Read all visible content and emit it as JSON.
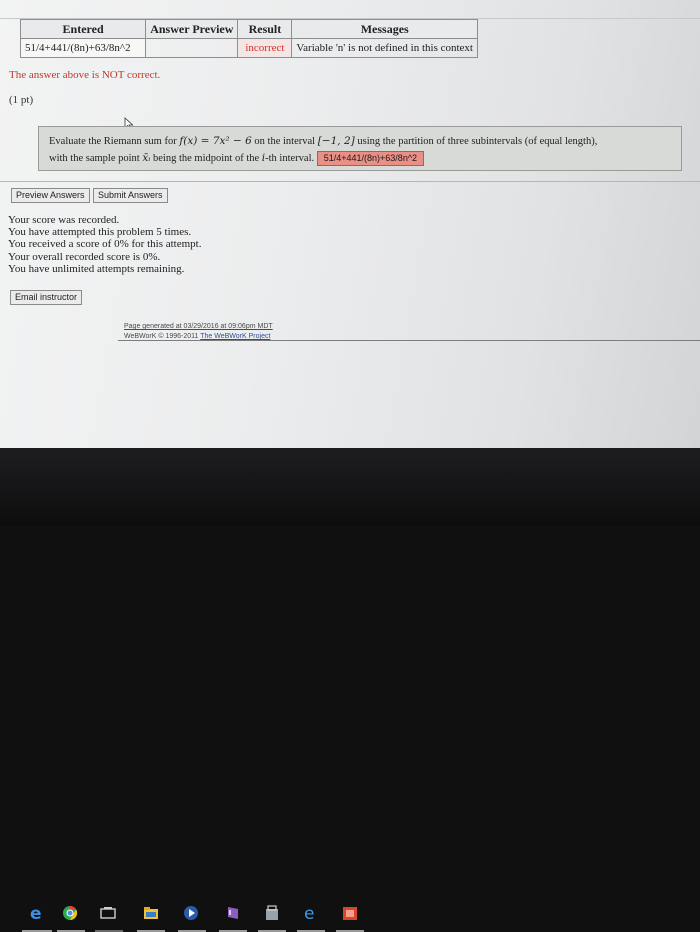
{
  "answer_table": {
    "headers": [
      "Entered",
      "Answer Preview",
      "Result",
      "Messages"
    ],
    "row": {
      "entered": "51/4+441/(8n)+63/8n^2",
      "preview": "",
      "result": "incorrect",
      "message": "Variable 'n' is not defined in this context"
    }
  },
  "feedback": {
    "status": "The answer above is NOT correct.",
    "points": "(1 pt)"
  },
  "problem": {
    "line1_a": "Evaluate the Riemann sum for",
    "function": "f(x) = 7x² − 6",
    "line1_b": "on the interval",
    "interval": "[−1, 2]",
    "line1_c": "using the partition of three subintervals (of equal length),",
    "line2_a": "with the sample point",
    "sample_point": "x̄ᵢ",
    "line2_b": "being the midpoint of the",
    "index": "i",
    "line2_c": "-th interval.",
    "answer_value": "51/4+441/(8n)+63/8n^2"
  },
  "buttons": {
    "preview": "Preview Answers",
    "submit": "Submit Answers",
    "email": "Email instructor"
  },
  "score": {
    "lines": [
      "Your score was recorded.",
      "You have attempted this problem 5 times.",
      "You received a score of 0% for this attempt.",
      "Your overall recorded score is 0%.",
      "You have unlimited attempts remaining."
    ]
  },
  "footer": {
    "generated": "Page generated at 03/29/2016 at 09:06pm MDT",
    "copyright": "WeBWorK © 1996-2011",
    "link": "The WeBWorK Project"
  },
  "taskbar": {
    "icons": [
      "internet-explorer-icon",
      "chrome-icon",
      "task-view-icon",
      "file-explorer-icon",
      "media-player-icon",
      "onenote-icon",
      "store-icon",
      "edge-icon",
      "office-icon"
    ]
  },
  "colors": {
    "incorrect": "#d6302a",
    "answer_field": "#e98f86",
    "problem_box": "#d8dad7",
    "link": "#2e4e92"
  }
}
